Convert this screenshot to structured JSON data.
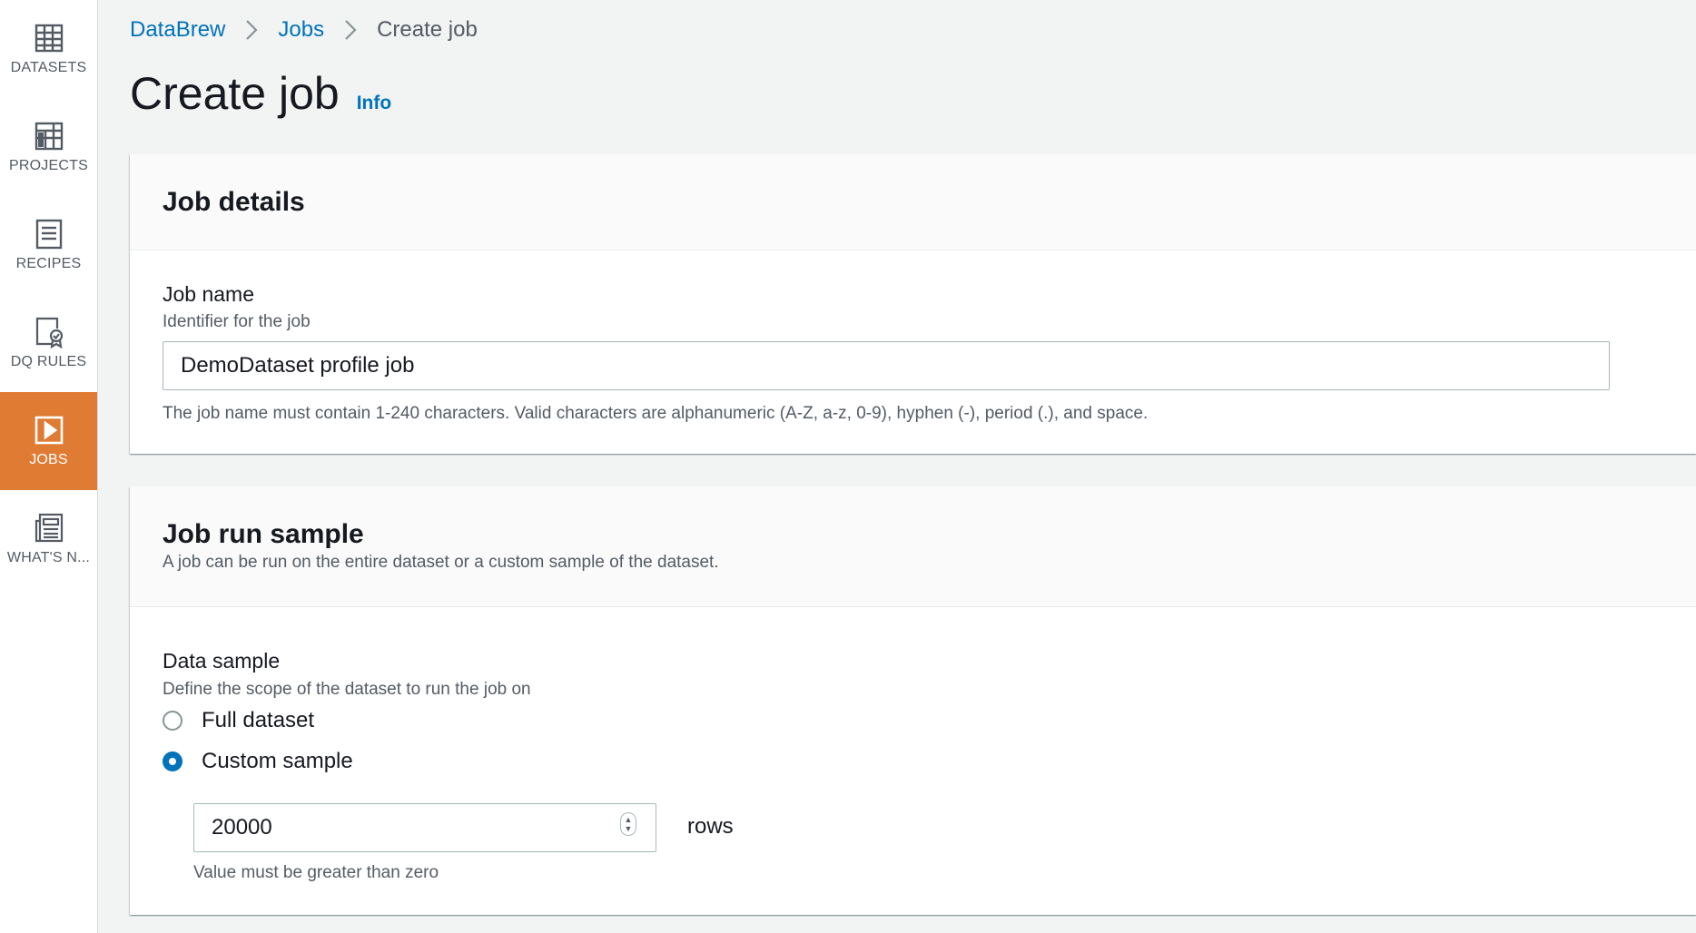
{
  "sidebar": {
    "items": [
      {
        "label": "DATASETS",
        "icon": "table-icon",
        "active": false
      },
      {
        "label": "PROJECTS",
        "icon": "grid-icon",
        "active": false
      },
      {
        "label": "RECIPES",
        "icon": "list-document-icon",
        "active": false
      },
      {
        "label": "DQ RULES",
        "icon": "certified-document-icon",
        "active": false
      },
      {
        "label": "JOBS",
        "icon": "play-icon",
        "active": true
      },
      {
        "label": "WHAT'S N...",
        "icon": "newspaper-icon",
        "active": false
      }
    ],
    "active_color": "#e07b34"
  },
  "breadcrumb": {
    "items": [
      "DataBrew",
      "Jobs",
      "Create job"
    ]
  },
  "page": {
    "title": "Create job",
    "info_label": "Info"
  },
  "job_details": {
    "heading": "Job details",
    "job_name": {
      "label": "Job name",
      "description": "Identifier for the job",
      "value": "DemoDataset profile job",
      "constraint": "The job name must contain 1-240 characters. Valid characters are alphanumeric (A-Z, a-z, 0-9), hyphen (-), period (.), and space."
    }
  },
  "job_run_sample": {
    "heading": "Job run sample",
    "description": "A job can be run on the entire dataset or a custom sample of the dataset.",
    "data_sample": {
      "label": "Data sample",
      "description": "Define the scope of the dataset to run the job on",
      "options": [
        {
          "label": "Full dataset",
          "selected": false
        },
        {
          "label": "Custom sample",
          "selected": true
        }
      ],
      "rows_value": "20000",
      "rows_unit": "rows",
      "rows_constraint": "Value must be greater than zero"
    }
  },
  "colors": {
    "link": "#0073bb",
    "background": "#f2f3f3"
  }
}
